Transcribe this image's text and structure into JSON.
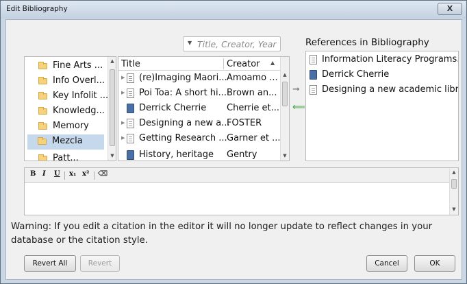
{
  "window": {
    "title": "Edit Bibliography",
    "close_label": "X"
  },
  "search": {
    "placeholder": "Title, Creator, Year"
  },
  "collections": {
    "items": [
      {
        "label": "Fine Arts ..."
      },
      {
        "label": "Info Overl..."
      },
      {
        "label": "Key Infolit ..."
      },
      {
        "label": "Knowledg..."
      },
      {
        "label": "Memory"
      },
      {
        "label": "Mezcla",
        "selected": true
      },
      {
        "label": "Patt..."
      }
    ]
  },
  "items_table": {
    "columns": {
      "title": "Title",
      "creator": "Creator"
    },
    "rows": [
      {
        "title": "(re)Imaging Maori...",
        "creator": "Amoamo ...",
        "icon": "document-icon"
      },
      {
        "title": "Poi Toa: A short hi...",
        "creator": "Brown an...",
        "icon": "document-icon"
      },
      {
        "title": "Derrick Cherrie",
        "creator": "Cherrie et...",
        "icon": "book-icon"
      },
      {
        "title": "Designing a new a...",
        "creator": "FOSTER",
        "icon": "document-icon"
      },
      {
        "title": "Getting Research ...",
        "creator": "Garner et ...",
        "icon": "document-icon"
      },
      {
        "title": "History, heritage",
        "creator": "Gentry",
        "icon": "book-icon"
      }
    ]
  },
  "bibliography": {
    "heading": "References in Bibliography",
    "items": [
      {
        "title": "Information Literacy Programs...",
        "icon": "document-icon"
      },
      {
        "title": "Derrick Cherrie",
        "icon": "book-icon"
      },
      {
        "title": "Designing a new academic libr...",
        "icon": "document-icon"
      }
    ]
  },
  "editor_toolbar": {
    "bold": "B",
    "italic": "I",
    "underline": "U",
    "subscript": "x₁",
    "superscript": "x²"
  },
  "warning": "Warning: If you edit a citation in the editor it will no longer update to reflect changes in your database or the citation style.",
  "buttons": {
    "revert_all": "Revert All",
    "revert": "Revert",
    "cancel": "Cancel",
    "ok": "OK"
  },
  "colors": {
    "selection": "#c6d9ec",
    "folder": "#f6d27e",
    "move_left_arrow": "#4ca64c"
  }
}
